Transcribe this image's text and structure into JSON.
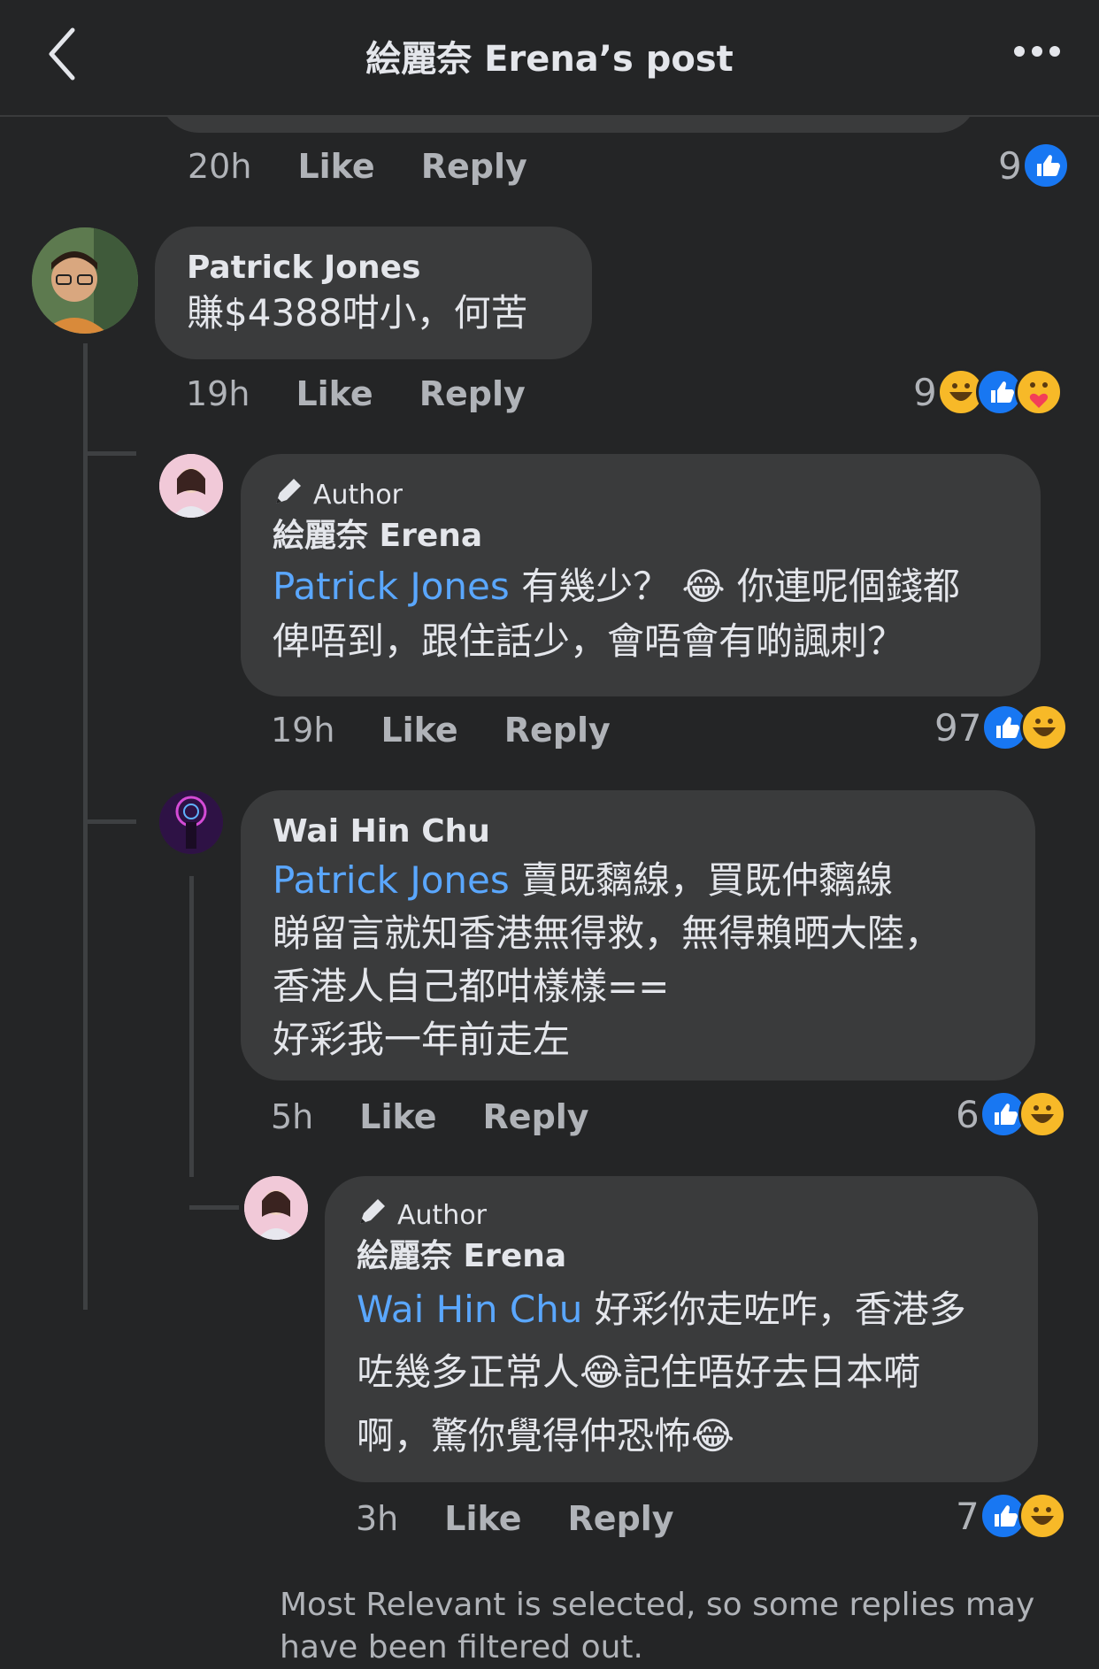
{
  "header": {
    "title": "絵麗奈 Erena’s post"
  },
  "prev_comment": {
    "time": "20h",
    "like_label": "Like",
    "reply_label": "Reply",
    "reaction_count": "9",
    "reactions": [
      "like-icon"
    ]
  },
  "comments": [
    {
      "author": "Patrick Jones",
      "text": "賺$4388咁小，何苦",
      "time": "19h",
      "like_label": "Like",
      "reply_label": "Reply",
      "reaction_count": "9",
      "reactions": [
        "haha-icon",
        "like-icon",
        "care-icon"
      ]
    },
    {
      "badge": "Author",
      "author": "絵麗奈 Erena",
      "mention": "Patrick Jones",
      "text_line1": " 有幾少？ 😂 你連呢個錢都",
      "text_line2": "俾唔到，跟住話少，會唔會有啲諷刺？",
      "time": "19h",
      "like_label": "Like",
      "reply_label": "Reply",
      "reaction_count": "97",
      "reactions": [
        "like-icon",
        "haha-icon"
      ]
    },
    {
      "author": "Wai Hin Chu",
      "mention": "Patrick Jones",
      "text_line1": " 賣既黐線，買既仲黐線",
      "text_line2": "睇留言就知香港無得救，無得賴晒大陸，",
      "text_line3": "香港人自己都咁樣樣==",
      "text_line4": "好彩我一年前走左",
      "time": "5h",
      "like_label": "Like",
      "reply_label": "Reply",
      "reaction_count": "6",
      "reactions": [
        "like-icon",
        "haha-icon"
      ]
    },
    {
      "badge": "Author",
      "author": "絵麗奈 Erena",
      "mention": "Wai Hin Chu",
      "text_line1": " 好彩你走咗咋，香港多",
      "text_line2": "咗幾多正常人😂記住唔好去日本嗬",
      "text_line3": "啊，驚你覺得仲恐怖😂",
      "time": "3h",
      "like_label": "Like",
      "reply_label": "Reply",
      "reaction_count": "7",
      "reactions": [
        "like-icon",
        "haha-icon"
      ]
    }
  ],
  "footer_note": "Most Relevant is selected, so some replies may have been filtered out.",
  "colors": {
    "background": "#242526",
    "bubble": "#3a3b3c",
    "mention": "#5aa7ff",
    "like": "#1877f2",
    "haha": "#f7b928"
  }
}
